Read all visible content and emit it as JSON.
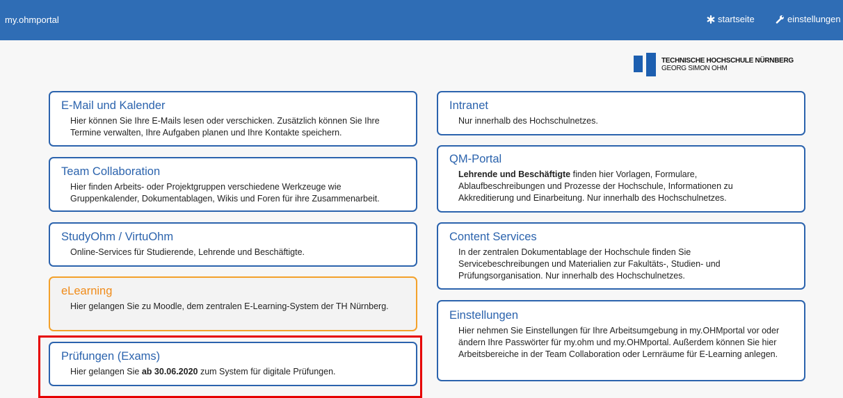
{
  "header": {
    "brand": "my.ohmportal",
    "start_label": "startseite",
    "settings_label": "einstellungen",
    "start_icon": "asterisk-icon",
    "settings_icon": "wrench-icon"
  },
  "logo": {
    "line1": "TECHNISCHE HOCHSCHULE NÜRNBERG",
    "line2": "GEORG SIMON OHM"
  },
  "cards": {
    "email": {
      "title": "E-Mail und Kalender",
      "desc": "Hier können Sie Ihre E-Mails lesen oder verschicken. Zusätzlich können Sie Ihre Termine verwalten, Ihre Aufgaben planen und Ihre Kontakte speichern."
    },
    "team": {
      "title": "Team Collaboration",
      "desc": "Hier finden Arbeits- oder Projektgruppen verschiedene Werkzeuge wie Gruppenkalender, Dokumentablagen, Wikis und Foren für ihre Zusammenarbeit."
    },
    "study": {
      "title": "StudyOhm / VirtuOhm",
      "desc": "Online-Services für Studierende, Lehrende und Beschäftigte."
    },
    "elearning": {
      "title": "eLearning",
      "desc": "Hier gelangen Sie zu Moodle, dem zentralen E-Learning-System der TH Nürnberg."
    },
    "exams": {
      "title": "Prüfungen (Exams)",
      "desc_pre": "Hier gelangen Sie ",
      "desc_bold": "ab 30.06.2020",
      "desc_post": " zum System für digitale Prüfungen."
    },
    "intranet": {
      "title": "Intranet",
      "desc": "Nur innerhalb des Hochschulnetzes."
    },
    "qm": {
      "title": "QM-Portal",
      "desc_bold": "Lehrende und Beschäftigte",
      "desc_post": " finden hier Vorlagen, Formulare, Ablaufbeschreibungen und Prozesse der Hochschule, Informationen zu Akkreditierung und Einarbeitung. Nur innerhalb des Hochschulnetzes."
    },
    "content": {
      "title": "Content Services",
      "desc": "In der zentralen Dokumentablage der Hochschule finden Sie Servicebeschreibungen und Materialien zur Fakultäts-, Studien- und Prüfungsorganisation. Nur innerhalb des Hochschulnetzes."
    },
    "settings": {
      "title": "Einstellungen",
      "desc": "Hier nehmen Sie Einstellungen für Ihre Arbeitsumgebung in my.OHMportal vor oder ändern Ihre Passwörter für my.ohm und my.OHMportal. Außerdem können Sie hier Arbeitsbereiche in der Team Collaboration oder Lernräume für E-Learning anlegen."
    }
  },
  "colors": {
    "header_bg": "#2f6db5",
    "card_border": "#2b63ad",
    "elearning_border": "#f3a12a",
    "highlight": "#e60000"
  }
}
